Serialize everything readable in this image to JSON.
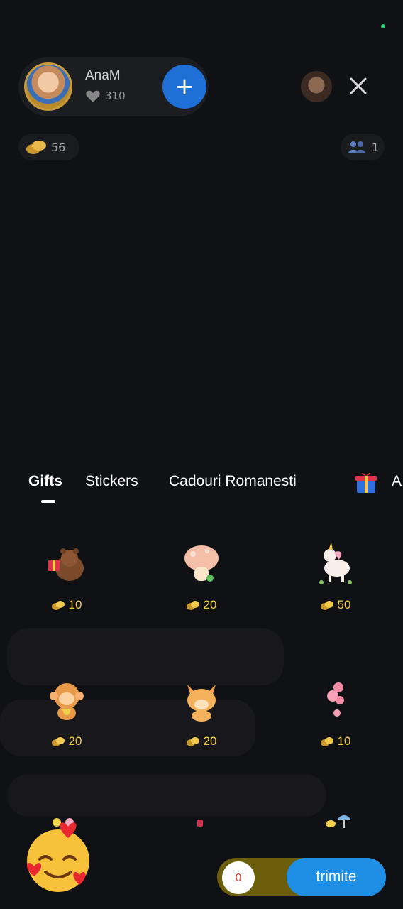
{
  "host": {
    "name": "AnaM",
    "likes": "310"
  },
  "balance": {
    "coins": "56",
    "viewers": "1"
  },
  "tabs": [
    {
      "label": "Gifts",
      "active": true
    },
    {
      "label": "Stickers",
      "active": false
    },
    {
      "label": "Cadouri Romanesti",
      "active": false
    },
    {
      "label": "A",
      "active": false
    }
  ],
  "gifts": [
    {
      "icon": "bear-with-gift-icon",
      "price": "10"
    },
    {
      "icon": "mushroom-icon",
      "price": "20"
    },
    {
      "icon": "unicorn-icon",
      "price": "50"
    },
    {
      "icon": "monkey-icon",
      "price": "20"
    },
    {
      "icon": "fox-icon",
      "price": "20"
    },
    {
      "icon": "flower-icon",
      "price": "10"
    }
  ],
  "send": {
    "count": "0",
    "label": "trimite"
  },
  "colors": {
    "background": "#101114",
    "accent_blue": "#1f8fe6",
    "coin_gold": "#f2c94c",
    "send_bar": "#6b5f0c"
  }
}
